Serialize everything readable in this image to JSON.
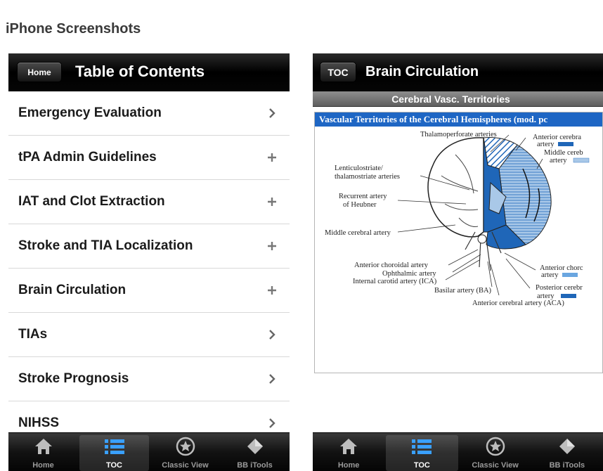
{
  "page": {
    "heading": "iPhone Screenshots"
  },
  "left_screen": {
    "nav_button": "Home",
    "nav_title": "Table of Contents",
    "items": [
      {
        "label": "Emergency Evaluation",
        "accessory": "chevron-right"
      },
      {
        "label": "tPA Admin Guidelines",
        "accessory": "plus"
      },
      {
        "label": "IAT and Clot Extraction",
        "accessory": "plus"
      },
      {
        "label": "Stroke and TIA Localization",
        "accessory": "plus"
      },
      {
        "label": "Brain Circulation",
        "accessory": "plus"
      },
      {
        "label": "TIAs",
        "accessory": "chevron-right"
      },
      {
        "label": "Stroke Prognosis",
        "accessory": "chevron-right"
      },
      {
        "label": "NIHSS",
        "accessory": "chevron-right"
      }
    ]
  },
  "right_screen": {
    "nav_button": "TOC",
    "nav_title": "Brain Circulation",
    "subheader": "Cerebral Vasc. Territories",
    "figure": {
      "title": "Vascular Territories of the Cerebral Hemispheres (mod. pc",
      "labels": {
        "thalamoperforate": "Thalamoperforate arteries",
        "anterior_cerebral_1": "Anterior cerebra",
        "anterior_cerebral_2": "artery",
        "middle_cerebral_1": "Middle cereb",
        "middle_cerebral_2": "artery",
        "lenticulostriate_1": "Lenticulostriate/",
        "lenticulostriate_2": "thalamostriate arteries",
        "recurrent_1": "Recurrent artery",
        "recurrent_2": "of Heubner",
        "middle_cerebral_artery": "Middle cerebral artery",
        "anterior_choroidal_artery": "Anterior choroidal artery",
        "ophthalmic": "Ophthalmic artery",
        "ica": "Internal carotid artery (ICA)",
        "basilar": "Basilar artery (BA)",
        "aca": "Anterior cerebral artery (ACA)",
        "anterior_choroidal_r1": "Anterior chorc",
        "anterior_choroidal_r2": "artery",
        "posterior_cerebral_1": "Posterior cerebr",
        "posterior_cerebral_2": "artery"
      },
      "colors": {
        "dark_blue": "#1f66b8",
        "light_blue": "#a9c8e8",
        "title_bar": "#1e66c4"
      }
    }
  },
  "tabbar": {
    "tabs": [
      {
        "label": "Home",
        "icon": "home-icon"
      },
      {
        "label": "TOC",
        "icon": "list-icon"
      },
      {
        "label": "Classic View",
        "icon": "star-circle-icon"
      },
      {
        "label": "BB iTools",
        "icon": "diamond-icon"
      }
    ],
    "selected": "TOC"
  }
}
